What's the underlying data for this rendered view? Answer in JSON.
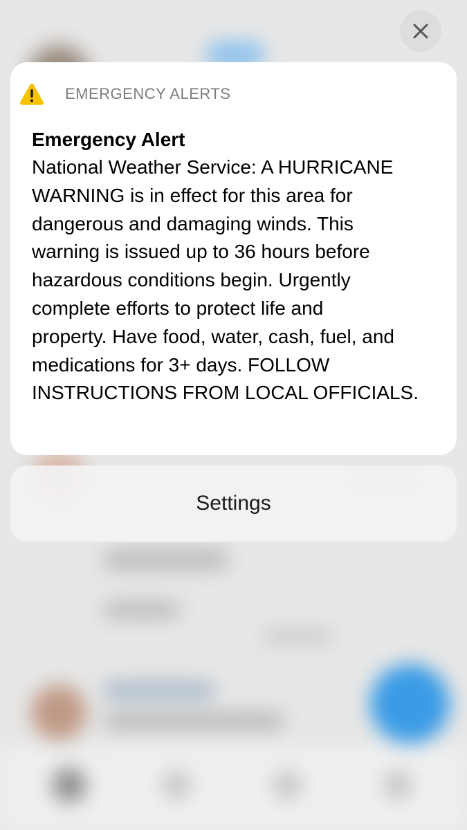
{
  "alert": {
    "app_name": "EMERGENCY ALERTS",
    "icon": "warning-triangle-icon",
    "icon_color": "#F7C300",
    "title": "Emergency Alert",
    "body": "National Weather Service: A HURRICANE\nWARNING is in effect for this area for\ndangerous and damaging winds. This\nwarning is issued up to 36 hours before\nhazardous conditions begin. Urgently\ncomplete efforts to protect life and\nproperty. Have food, water, cash, fuel, and\nmedications for 3+ days. FOLLOW\nINSTRUCTIONS FROM LOCAL OFFICIALS."
  },
  "actions": {
    "settings_label": "Settings",
    "close_icon": "close-icon"
  },
  "colors": {
    "card_background": "#FFFFFF",
    "dimmed_background": "#E7E7E7",
    "secondary_text": "#7C7C80",
    "accent_blue": "#3A9BE6"
  }
}
